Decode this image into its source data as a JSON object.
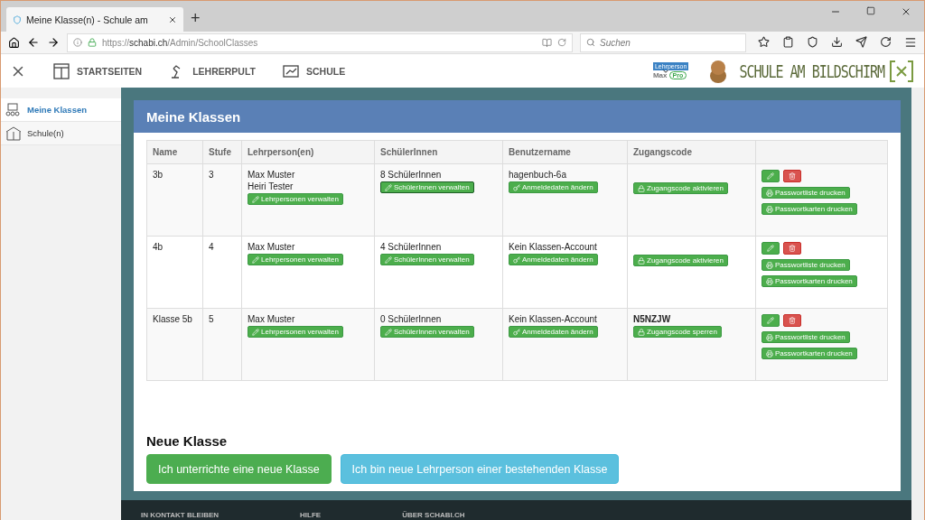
{
  "browser": {
    "tab_title": "Meine Klasse(n) - Schule am",
    "new_tab": "+",
    "url": "https://**schabi.ch**/Admin/SchoolClasses",
    "search_placeholder": "Suchen"
  },
  "nav": {
    "items": [
      {
        "label": "STARTSEITEN",
        "kind": "pages"
      },
      {
        "label": "LEHRERPULT",
        "kind": "lamp"
      },
      {
        "label": "SCHULE",
        "kind": "chart"
      }
    ]
  },
  "user": {
    "role": "Lehrperson",
    "name": "Max",
    "plan": "Pro"
  },
  "logo": {
    "text": "SCHULE AM BILDSCHIRM"
  },
  "sidebar": {
    "items": [
      {
        "label": "Meine Klassen",
        "selected": true,
        "kind": "class"
      },
      {
        "label": "Schule(n)",
        "selected": false,
        "kind": "school"
      }
    ]
  },
  "panel": {
    "title": "Meine Klassen"
  },
  "table": {
    "columns": [
      "Name",
      "Stufe",
      "Lehrperson(en)",
      "SchülerInnen",
      "Benutzername",
      "Zugangscode",
      ""
    ],
    "rows": [
      {
        "name": "3b",
        "level": "3",
        "teachers": [
          "Max Muster",
          "Heiri Tester"
        ],
        "teachers_button": "Lehrpersonen verwalten",
        "students": "8 SchülerInnen",
        "students_button": "SchülerInnen verwalten",
        "students_button_focused": true,
        "username": "hagenbuch-6a",
        "username_button": "Anmeldedaten ändern",
        "code": "",
        "code_button": "Zugangscode aktivieren",
        "print_buttons": [
          "Passwortliste drucken",
          "Passwortkarten drucken"
        ]
      },
      {
        "name": "4b",
        "level": "4",
        "teachers": [
          "Max Muster"
        ],
        "teachers_button": "Lehrpersonen verwalten",
        "students": "4 SchülerInnen",
        "students_button": "SchülerInnen verwalten",
        "students_button_focused": false,
        "username": "Kein Klassen-Account",
        "username_button": "Anmeldedaten ändern",
        "code": "",
        "code_button": "Zugangscode aktivieren",
        "print_buttons": [
          "Passwortliste drucken",
          "Passwortkarten drucken"
        ]
      },
      {
        "name": "Klasse 5b",
        "level": "5",
        "teachers": [
          "Max Muster"
        ],
        "teachers_button": "Lehrpersonen verwalten",
        "students": "0 SchülerInnen",
        "students_button": "SchülerInnen verwalten",
        "students_button_focused": false,
        "username": "Kein Klassen-Account",
        "username_button": "Anmeldedaten ändern",
        "code": "N5NZJW",
        "code_button": "Zugangscode sperren",
        "print_buttons": [
          "Passwortliste drucken",
          "Passwortkarten drucken"
        ]
      }
    ]
  },
  "new_class": {
    "title": "Neue Klasse",
    "buttons": [
      {
        "label": "Ich unterrichte eine neue Klasse",
        "kind": "success"
      },
      {
        "label": "Ich bin neue Lehrperson einer bestehenden Klasse",
        "kind": "info"
      }
    ]
  },
  "footer": {
    "headings": [
      "IN KONTAKT BLEIBEN",
      "HILFE",
      "ÜBER SCHABI.CH"
    ]
  }
}
